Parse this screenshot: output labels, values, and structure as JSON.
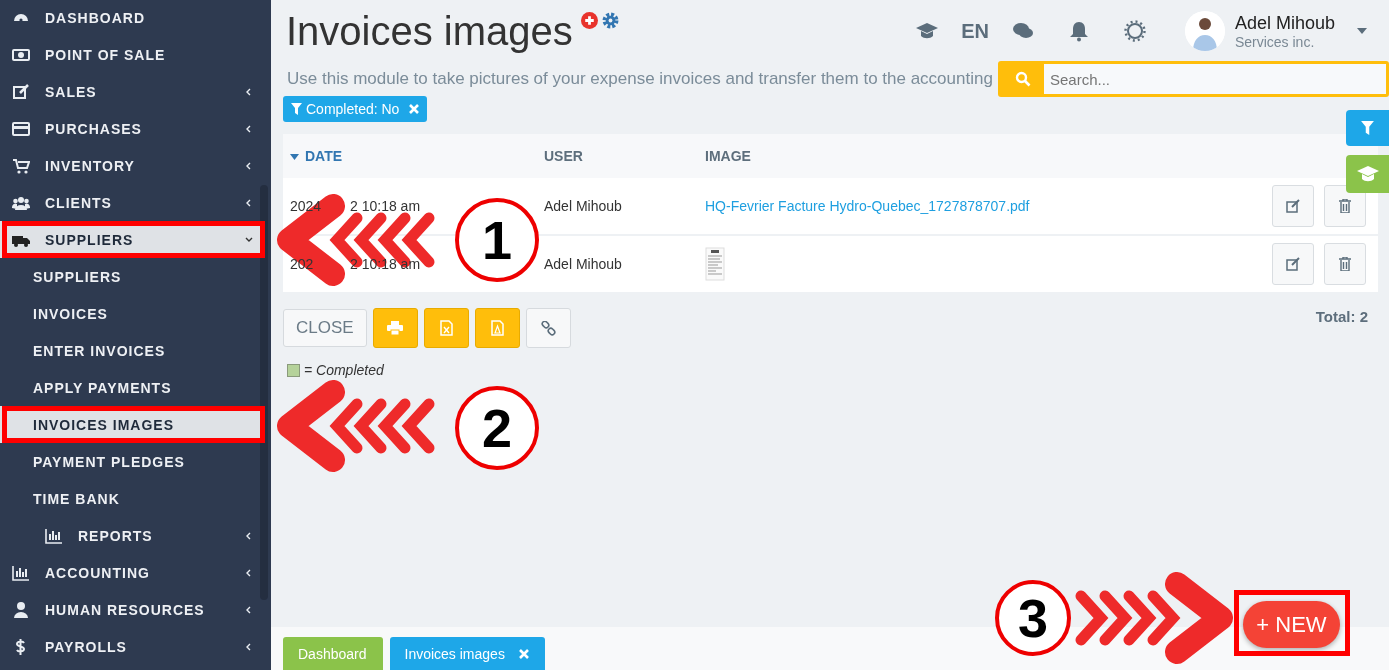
{
  "sidebar": {
    "items": [
      {
        "label": "DASHBOARD",
        "expandable": false,
        "expanded": false,
        "selected": false
      },
      {
        "label": "POINT OF SALE",
        "expandable": false,
        "expanded": false,
        "selected": false
      },
      {
        "label": "SALES",
        "expandable": true,
        "expanded": false,
        "selected": false
      },
      {
        "label": "PURCHASES",
        "expandable": true,
        "expanded": false,
        "selected": false
      },
      {
        "label": "INVENTORY",
        "expandable": true,
        "expanded": false,
        "selected": false
      },
      {
        "label": "CLIENTS",
        "expandable": true,
        "expanded": false,
        "selected": false
      },
      {
        "label": "SUPPLIERS",
        "expandable": true,
        "expanded": true,
        "selected": true,
        "children": [
          {
            "label": "SUPPLIERS",
            "expandable": false,
            "selected": false
          },
          {
            "label": "INVOICES",
            "expandable": false,
            "selected": false
          },
          {
            "label": "ENTER INVOICES",
            "expandable": false,
            "selected": false
          },
          {
            "label": "APPLY PAYMENTS",
            "expandable": false,
            "selected": false
          },
          {
            "label": "INVOICES IMAGES",
            "expandable": false,
            "selected": true
          },
          {
            "label": "PAYMENT PLEDGES",
            "expandable": false,
            "selected": false
          },
          {
            "label": "TIME BANK",
            "expandable": false,
            "selected": false
          },
          {
            "label": "REPORTS",
            "expandable": true,
            "selected": false
          }
        ]
      },
      {
        "label": "ACCOUNTING",
        "expandable": true,
        "expanded": false,
        "selected": false
      },
      {
        "label": "HUMAN RESOURCES",
        "expandable": true,
        "expanded": false,
        "selected": false
      },
      {
        "label": "PAYROLLS",
        "expandable": true,
        "expanded": false,
        "selected": false
      }
    ]
  },
  "header": {
    "title": "Invoices images",
    "subtitle": "Use this module to take pictures of your expense invoices and transfer them to the accounting",
    "language": "EN",
    "user": {
      "name": "Adel Mihoub",
      "company": "Services inc."
    },
    "search": {
      "placeholder": "Search..."
    }
  },
  "filters": [
    {
      "label": "Completed: No"
    }
  ],
  "table": {
    "columns": [
      {
        "label": "DATE",
        "sorted": true
      },
      {
        "label": "USER",
        "sorted": false
      },
      {
        "label": "IMAGE",
        "sorted": false
      }
    ],
    "rows": [
      {
        "date_start": "2024",
        "date_end": "2 10:18 am",
        "user": "Adel Mihoub",
        "image": {
          "kind": "link",
          "text": "HQ-Fevrier Facture Hydro-Quebec_1727878707.pdf"
        }
      },
      {
        "date_start": "202",
        "date_end": "2 10:18 am",
        "user": "Adel Mihoub",
        "image": {
          "kind": "thumbnail"
        }
      }
    ]
  },
  "toolbar": {
    "close": "CLOSE",
    "total": "Total: 2"
  },
  "legend": {
    "text": "= Completed",
    "color": "#b5d29a"
  },
  "bottom_tabs": [
    {
      "label": "Dashboard",
      "selected": false,
      "closable": false
    },
    {
      "label": "Invoices images",
      "selected": true,
      "closable": true
    }
  ],
  "new_button": {
    "label": "+ NEW"
  },
  "callouts": [
    {
      "number": "1"
    },
    {
      "number": "2"
    },
    {
      "number": "3"
    }
  ]
}
